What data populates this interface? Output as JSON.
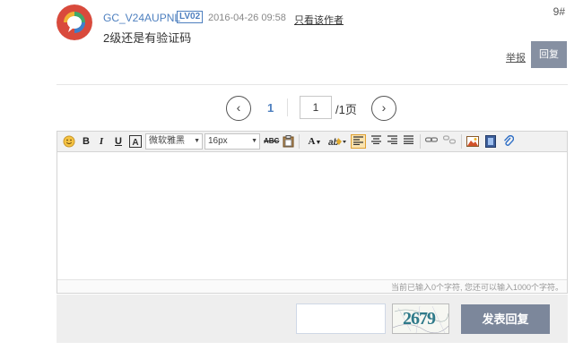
{
  "post": {
    "username": "GC_V24AUPNL",
    "level": "LV02",
    "time": "2016-04-26 09:58",
    "only_author": "只看该作者",
    "floor": "9#",
    "content": "2级还是有验证码",
    "report": "举报",
    "reply": "回复"
  },
  "pager": {
    "prev_icon": "chevron-left-icon",
    "current": "1",
    "input_value": "1",
    "total": "/1页",
    "next_icon": "chevron-right-icon"
  },
  "editor": {
    "font_family": "微软雅黑",
    "font_size": "16px",
    "char_count": "当前已输入0个字符, 您还可以输入1000个字符。"
  },
  "submit": {
    "captcha_value": "",
    "captcha_text": "2679",
    "submit_label": "发表回复"
  },
  "colors": {
    "link_blue": "#4d7fbf",
    "reply_button": "#8690a2",
    "submit_button": "#7c879b",
    "submit_bar": "#eeeeee"
  }
}
